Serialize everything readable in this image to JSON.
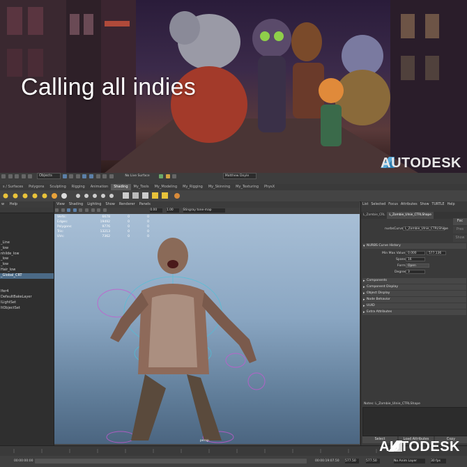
{
  "banner": {
    "headline": "Calling all indies",
    "brand": "AUTODESK"
  },
  "footer_brand": "AUTODESK",
  "maya": {
    "menu_items": [
      "Objects",
      "No Live Surface",
      "Matthew Doyle"
    ],
    "shelf_tabs": [
      "s / Surfaces",
      "Polygons",
      "Sculpting",
      "Rigging",
      "Animation",
      "Shading",
      "My_Tools",
      "My_Modeling",
      "My_Rigging",
      "My_Skinning",
      "My_Texturing",
      "PhysX"
    ],
    "shelf_active": "Shading",
    "outliner": {
      "header_left": "w",
      "header_help": "Help",
      "items": [
        "",
        "",
        "",
        "",
        "",
        "_Line",
        "_low",
        "nhilde_low",
        "_low",
        "_low",
        "Hair_low",
        "_Global_CRT",
        "",
        "",
        "lfer4",
        "DefaultBakeLayer",
        "lLightSet",
        "ltObjectSet"
      ],
      "selected_index": 11
    },
    "viewport_menu": [
      "View",
      "Shading",
      "Lighting",
      "Show",
      "Renderer",
      "Panels"
    ],
    "viewport_toolbar": {
      "value1": "0.00",
      "value2": "1.00",
      "colorspace": "Stingray tone-map"
    },
    "hud": {
      "rows": [
        {
          "label": "Verts:",
          "a": "6678",
          "b": "0",
          "c": "0"
        },
        {
          "label": "Edges:",
          "a": "19492",
          "b": "0",
          "c": "0"
        },
        {
          "label": "Polygons:",
          "a": "9776",
          "b": "0",
          "c": "0"
        },
        {
          "label": "Tris:",
          "a": "13213",
          "b": "0",
          "c": "0"
        },
        {
          "label": "UVs:",
          "a": "7362",
          "b": "0",
          "c": "0"
        }
      ]
    },
    "camera_label": "persp",
    "attribute_editor": {
      "menu": [
        "List",
        "Selected",
        "Focus",
        "Attributes",
        "Show",
        "TURTLE",
        "Help"
      ],
      "tabs": [
        "L_Zombie_CRL",
        "L_Zombie_Ulnie_CTRLShape",
        ""
      ],
      "active_tab": 1,
      "node_label": "nurbsCurve:",
      "node_value": "L_Zombie_Ulnie_CTRLShape",
      "focus_button": "Foc",
      "presets_button": "Pres",
      "show_button": "Show",
      "sections": [
        {
          "label": "NURBS Curve History",
          "open": true
        },
        {
          "label": "Components",
          "open": false
        },
        {
          "label": "Component Display",
          "open": false
        },
        {
          "label": "Object Display",
          "open": false
        },
        {
          "label": "Node Behavior",
          "open": false
        },
        {
          "label": "UUID",
          "open": false
        },
        {
          "label": "Extra Attributes",
          "open": false
        }
      ],
      "fields": {
        "min_max_label": "Min Max Value",
        "min_value": "0.000",
        "max_value": "577.136",
        "spans_label": "Spans",
        "spans_value": "16",
        "form_label": "Form",
        "form_value": "Open",
        "degree_label": "Degree",
        "degree_value": "3"
      },
      "notes_label": "Notes: L_Zombie_Ulnie_CTRLShape",
      "select_button": "Select",
      "load_button": "Load Attributes",
      "copy_button": "Copy"
    },
    "range": {
      "current_time": "00:00:00:00",
      "end_time": "00:00:19:07.50",
      "start_val": "577.50",
      "end_val": "577.50",
      "anim_layer": "No Anim Layer",
      "fps": "30 fps"
    }
  }
}
